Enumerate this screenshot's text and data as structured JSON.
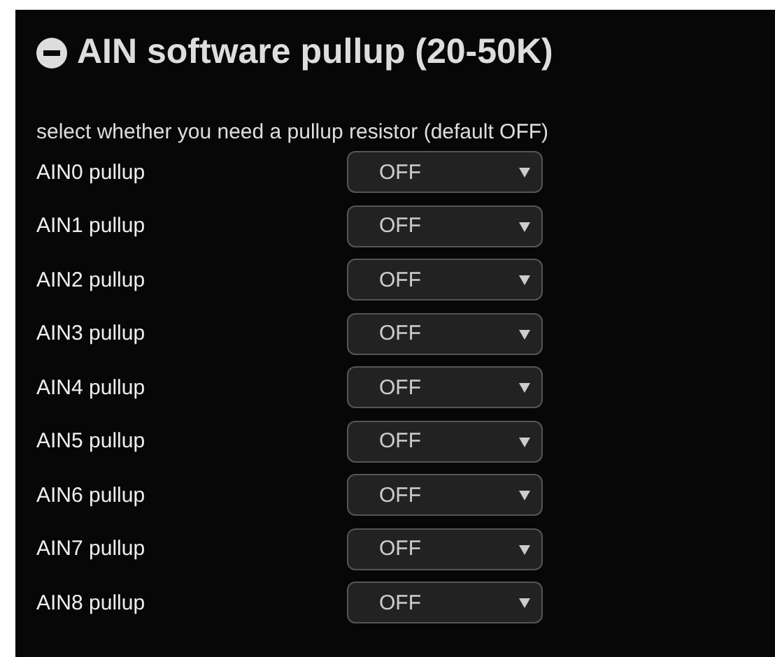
{
  "section": {
    "title": "AIN software pullup (20-50K)",
    "expanded": true,
    "description": "select whether you need a pullup resistor (default OFF)"
  },
  "rows": [
    {
      "label": "AIN0 pullup",
      "value": "OFF"
    },
    {
      "label": "AIN1 pullup",
      "value": "OFF"
    },
    {
      "label": "AIN2 pullup",
      "value": "OFF"
    },
    {
      "label": "AIN3 pullup",
      "value": "OFF"
    },
    {
      "label": "AIN4 pullup",
      "value": "OFF"
    },
    {
      "label": "AIN5 pullup",
      "value": "OFF"
    },
    {
      "label": "AIN6 pullup",
      "value": "OFF"
    },
    {
      "label": "AIN7 pullup",
      "value": "OFF"
    },
    {
      "label": "AIN8 pullup",
      "value": "OFF"
    }
  ]
}
